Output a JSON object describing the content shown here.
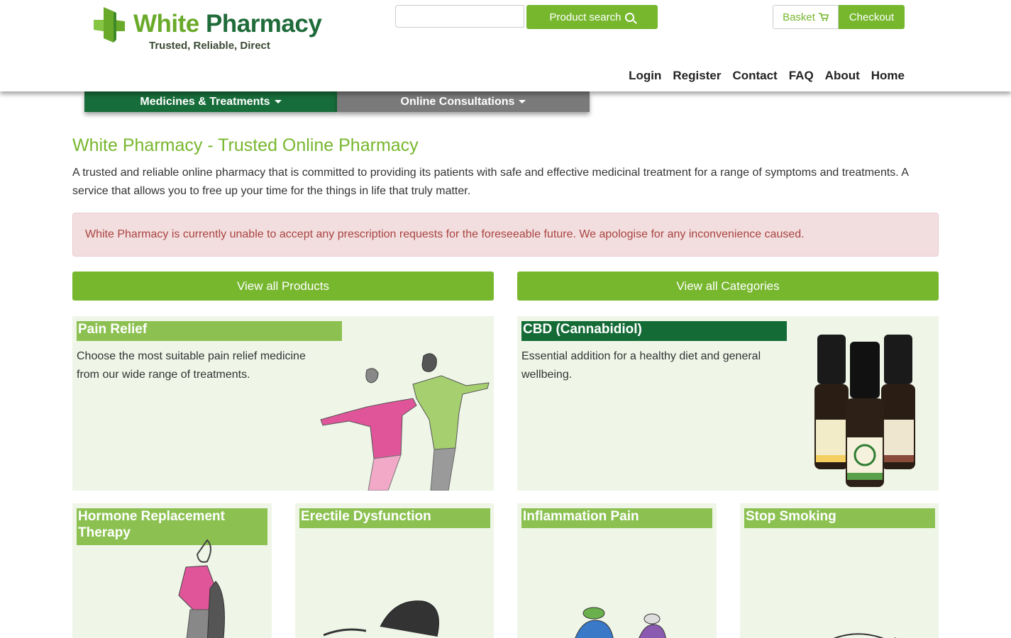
{
  "brand": {
    "title_part1": "White",
    "title_part2": "Pharmacy",
    "tagline": "Trusted, Reliable, Direct"
  },
  "search": {
    "placeholder": "",
    "button_label": "Product search"
  },
  "cart": {
    "basket_label": "Basket",
    "checkout_label": "Checkout"
  },
  "topnav": [
    "Login",
    "Register",
    "Contact",
    "FAQ",
    "About",
    "Home"
  ],
  "catnav": {
    "medicines": "Medicines & Treatments",
    "consultations": "Online Consultations"
  },
  "main": {
    "title": "White Pharmacy - Trusted Online Pharmacy",
    "intro": "A trusted and reliable online pharmacy that is committed to providing its patients with safe and effective medicinal treatment for a range of symptoms and treatments. A service that allows you to free up your time for the things in life that truly matter.",
    "alert": "White Pharmacy is currently unable to accept any prescription requests for the foreseeable future. We apologise for any inconvenience caused.",
    "view_products": "View all Products",
    "view_categories": "View all Categories"
  },
  "cards": {
    "pain": {
      "title": "Pain Relief",
      "text1": "Choose the most suitable pain relief medicine",
      "text2": "from our wide range of treatments."
    },
    "cbd": {
      "title": "CBD (Cannabidiol)",
      "text1": "Essential addition for a healthy diet and general",
      "text2": "wellbeing."
    },
    "hrt": {
      "title1": "Hormone Replacement",
      "title2": "Therapy"
    },
    "ed": {
      "title": "Erectile Dysfunction"
    },
    "inflammation": {
      "title": "Inflammation Pain"
    },
    "smoking": {
      "title": "Stop Smoking"
    }
  },
  "colors": {
    "brand_green": "#77b72e",
    "dark_green": "#176d3a",
    "light_green": "#8cc152",
    "card_bg": "#eff6e8",
    "alert_bg": "#f2dede",
    "alert_text": "#a94442"
  }
}
